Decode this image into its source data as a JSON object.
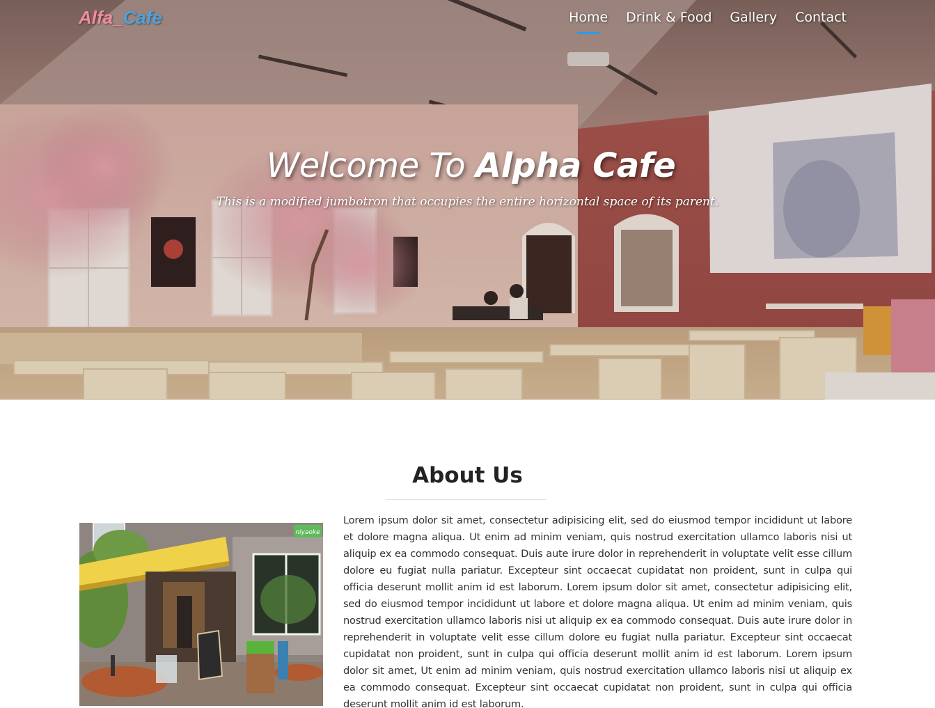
{
  "nav": {
    "brand_part1": "Alfa_",
    "brand_part2": "Cafe",
    "links": [
      "Home",
      "Drink & Food",
      "Gallery",
      "Contact"
    ],
    "active": "Home"
  },
  "hero": {
    "title_light": "Welcome To ",
    "title_bold": "Alpha Cafe",
    "subtitle": "This is a modified jumbotron that occupies the entire horizontal space of its parent."
  },
  "about": {
    "heading": "About Us",
    "photo_sign": "niyaoke",
    "body": "Lorem ipsum dolor sit amet, consectetur adipisicing elit, sed do eiusmod tempor incididunt ut labore et dolore magna aliqua. Ut enim ad minim veniam, quis nostrud exercitation ullamco laboris nisi ut aliquip ex ea commodo consequat. Duis aute irure dolor in reprehenderit in voluptate velit esse cillum dolore eu fugiat nulla pariatur. Excepteur sint occaecat cupidatat non proident, sunt in culpa qui officia deserunt mollit anim id est laborum. Lorem ipsum dolor sit amet, consectetur adipisicing elit, sed do eiusmod tempor incididunt ut labore et dolore magna aliqua. Ut enim ad minim veniam, quis nostrud exercitation ullamco laboris nisi ut aliquip ex ea commodo consequat. Duis aute irure dolor in reprehenderit in voluptate velit esse cillum dolore eu fugiat nulla pariatur. Excepteur sint occaecat cupidatat non proident, sunt in culpa qui officia deserunt mollit anim id est laborum. Lorem ipsum dolor sit amet, Ut enim ad minim veniam, quis nostrud exercitation ullamco laboris nisi ut aliquip ex ea commodo consequat. Excepteur sint occaecat cupidatat non proident, sunt in culpa qui officia deserunt mollit anim id est laborum."
  },
  "colors": {
    "brand_pink": "#f08ca0",
    "brand_blue": "#4ba3e3",
    "nav_active_underline": "#2f9be6"
  }
}
